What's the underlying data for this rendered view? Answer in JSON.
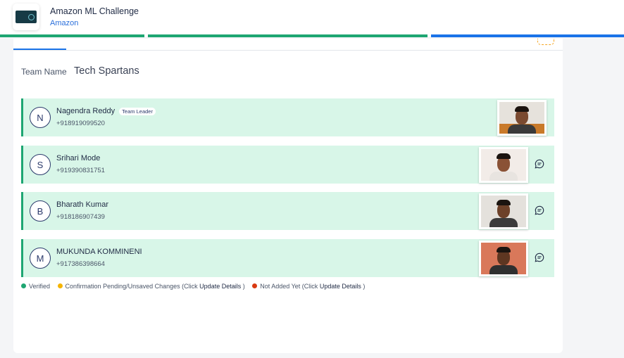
{
  "header": {
    "title": "Amazon ML Challenge",
    "subtitle": "Amazon",
    "logo_icon": "amazon-ml-challenge-logo"
  },
  "progress": {
    "steps": [
      {
        "status": "complete",
        "color": "#1ea672"
      },
      {
        "status": "complete",
        "color": "#1ea672"
      },
      {
        "status": "active",
        "color": "#1a73e8"
      }
    ]
  },
  "team": {
    "label": "Team Name",
    "name": "Tech Spartans"
  },
  "members": [
    {
      "initial": "N",
      "name": "Nagendra Reddy",
      "badge": "Team Leader",
      "phone": "+918919099520",
      "has_chat": false
    },
    {
      "initial": "S",
      "name": "Srihari Mode",
      "badge": "",
      "phone": "+919390831751",
      "has_chat": true
    },
    {
      "initial": "B",
      "name": "Bharath Kumar",
      "badge": "",
      "phone": "+918186907439",
      "has_chat": true
    },
    {
      "initial": "M",
      "name": "MUKUNDA KOMMINENI",
      "badge": "",
      "phone": "+917386398664",
      "has_chat": true
    }
  ],
  "legend": {
    "verified": {
      "text": "Verified",
      "color": "#1ea672"
    },
    "pending": {
      "text": "Confirmation Pending/Unsaved Changes (Click",
      "link": "Update Details",
      "close": ")",
      "color": "#f5b400"
    },
    "not_added": {
      "text": "Not Added Yet (Click",
      "link": "Update Details",
      "close": ")",
      "color": "#d93a12"
    }
  },
  "colors": {
    "accent_green": "#1ea672",
    "accent_blue": "#1a73e8",
    "row_bg": "#d8f6e8"
  }
}
